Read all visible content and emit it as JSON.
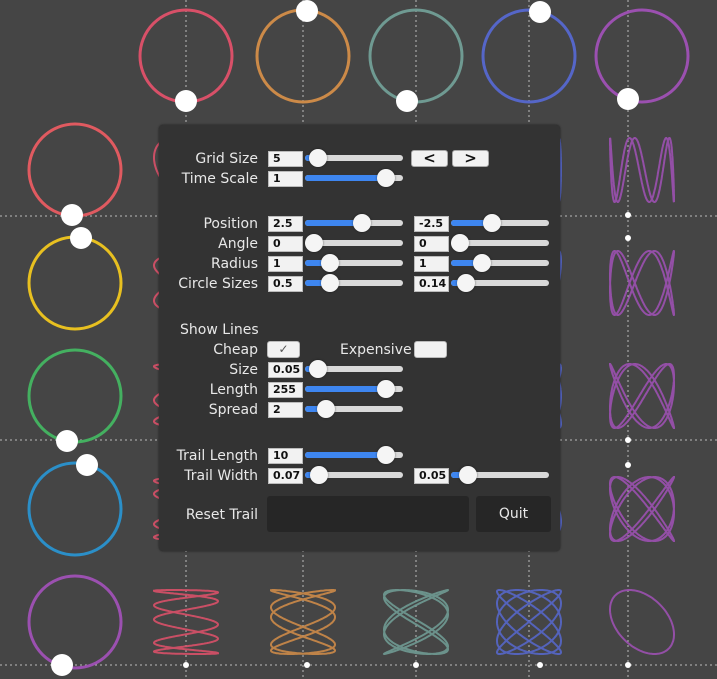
{
  "panel": {
    "grid_size": {
      "label": "Grid Size",
      "value": "5",
      "slider": 0.05,
      "prev_label": "<",
      "next_label": ">"
    },
    "time_scale": {
      "label": "Time Scale",
      "value": "1",
      "slider": 0.9
    },
    "position": {
      "label": "Position",
      "value_a": "2.5",
      "slider_a": 0.6,
      "value_b": "-2.5",
      "slider_b": 0.4
    },
    "angle": {
      "label": "Angle",
      "value_a": "0",
      "slider_a": 0.0,
      "value_b": "0",
      "slider_b": 0.0
    },
    "radius": {
      "label": "Radius",
      "value_a": "1",
      "slider_a": 0.2,
      "value_b": "1",
      "slider_b": 0.27
    },
    "circle_sizes": {
      "label": "Circle Sizes",
      "value_a": "0.5",
      "slider_a": 0.2,
      "value_b": "0.14",
      "slider_b": 0.07
    },
    "show_lines": {
      "label": "Show Lines"
    },
    "cheap": {
      "label": "Cheap",
      "checked": true,
      "check_glyph": "✓"
    },
    "expensive": {
      "label": "Expensive",
      "checked": false
    },
    "size": {
      "label": "Size",
      "value": "0.05",
      "slider": 0.05
    },
    "length": {
      "label": "Length",
      "value": "255",
      "slider": 0.9
    },
    "spread": {
      "label": "Spread",
      "value": "2",
      "slider": 0.15
    },
    "trail_length": {
      "label": "Trail Length",
      "value": "10",
      "slider": 0.9
    },
    "trail_width": {
      "label": "Trail Width",
      "value_a": "0.07",
      "slider_a": 0.06,
      "value_b": "0.05",
      "slider_b": 0.1
    },
    "reset_trail": {
      "label": "Reset Trail"
    },
    "quit": {
      "label": "Quit"
    }
  },
  "colors": {
    "background": "#454545",
    "panel": "#333333",
    "accent": "#3e86f0",
    "rows": [
      "#e05a60",
      "#e8c020",
      "#44b060",
      "#2b8fc8",
      "#9b50b0"
    ],
    "cols": [
      "#d85068",
      "#cc8a48",
      "#6f9a92",
      "#5566c8",
      "#9b50b0"
    ]
  }
}
